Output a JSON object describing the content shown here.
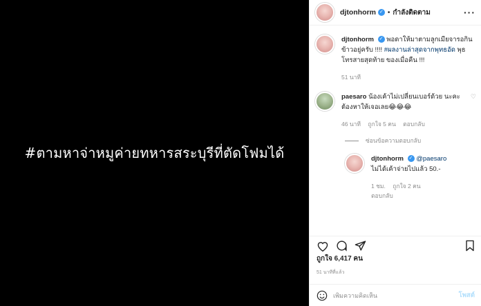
{
  "media": {
    "text": "#ตามหาจ่าหมูค่ายทหารสระบุรีที่ตัดโฟมได้"
  },
  "header": {
    "username": "djtonhorm",
    "separator": "•",
    "follow_status": "กำลังติดตาม",
    "more_icon": "more-dots-icon"
  },
  "caption": {
    "username": "djtonhorm",
    "text_1": "พอดาให้มาตามลูกเมียจารอกินข้าวอยู่ครับ !!!! ",
    "hashtag": "#ผลงานล่าสุดจากพุทธอัด",
    "text_2": " พุธโทรสายสุดท้าย ของเมื่อคืน !!!",
    "time": "51 นาที"
  },
  "comment": {
    "username": "paesaro",
    "text": "น้องเค้าไม่เปลี่ยนเบอร์ด้วย นะคะต้องหาให้เจอเลย😂😂😂",
    "time": "46 นาที",
    "likes": "ถูกใจ 5 คน",
    "reply": "ตอบกลับ",
    "view_replies": "ซ่อนข้อความตอบกลับ"
  },
  "reply": {
    "username": "djtonhorm",
    "mention": "@paesaro",
    "text": "ไม่ได้เค้าจ่ายไปแล้ว 50.-",
    "time": "1 ชม.",
    "likes": "ถูกใจ 2 คน",
    "reply": "ตอบกลับ"
  },
  "actions": {
    "likes": "ถูกใจ 6,417 คน",
    "time_ago": "51 นาทีที่แล้ว"
  },
  "composer": {
    "placeholder": "เพิ่มความคิดเห็น",
    "post": "โพสต์"
  },
  "colors": {
    "verified": "#3897f0",
    "link": "#00376b",
    "post_disabled": "#b2dffc",
    "muted": "#8e8e8e"
  }
}
